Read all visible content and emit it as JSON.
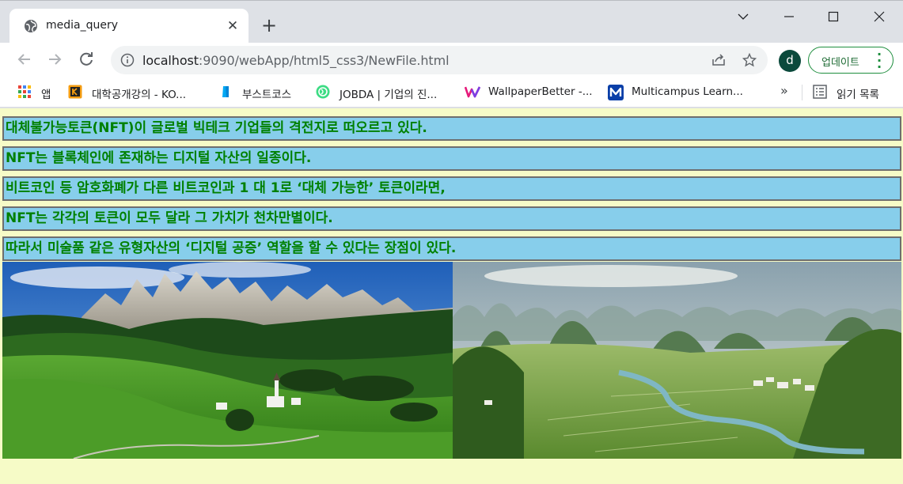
{
  "browser": {
    "tab": {
      "title": "media_query",
      "favicon": "globe-icon",
      "close": "✕"
    },
    "new_tab": "+",
    "window_controls": [
      "chevron-down-icon",
      "minimize-icon",
      "maximize-icon",
      "close-icon"
    ],
    "url": {
      "host": "localhost",
      "path": ":9090/webApp/html5_css3/NewFile.html"
    },
    "profile_initial": "d",
    "update_label": "업데이트",
    "bookmarks": [
      {
        "label": "앱",
        "icon": "apps-grid-icon"
      },
      {
        "label": "대학공개강의 - KO...",
        "icon": "kocw-icon"
      },
      {
        "label": "부스트코스",
        "icon": "boostcourse-icon"
      },
      {
        "label": "JOBDA | 기업의 진...",
        "icon": "jobda-icon"
      },
      {
        "label": "WallpaperBetter -...",
        "icon": "wallpaperbetter-icon"
      },
      {
        "label": "Multicampus Learn...",
        "icon": "multicampus-icon"
      }
    ],
    "bookmarks_more": "»",
    "reading_list": "읽기 목록"
  },
  "content": {
    "lines": [
      "대체불가능토큰(NFT)이 글로벌 빅테크 기업들의 격전지로 떠오르고 있다.",
      "NFT는 블록체인에 존재하는 디지털 자산의 일종이다.",
      "비트코인 등 암호화폐가 다른 비트코인과 1 대 1로 ‘대체 가능한’ 토큰이라면,",
      "NFT는 각각의 토큰이 모두 달라 그 가치가 천차만별이다.",
      "따라서 미술품 같은 유형자산의 ‘디지털 공증’ 역할을 할 수 있다는 장점이 있다."
    ],
    "colors": {
      "box_bg": "#87ceeb",
      "text": "#008000",
      "page_bg": "#f6fbc7"
    }
  }
}
